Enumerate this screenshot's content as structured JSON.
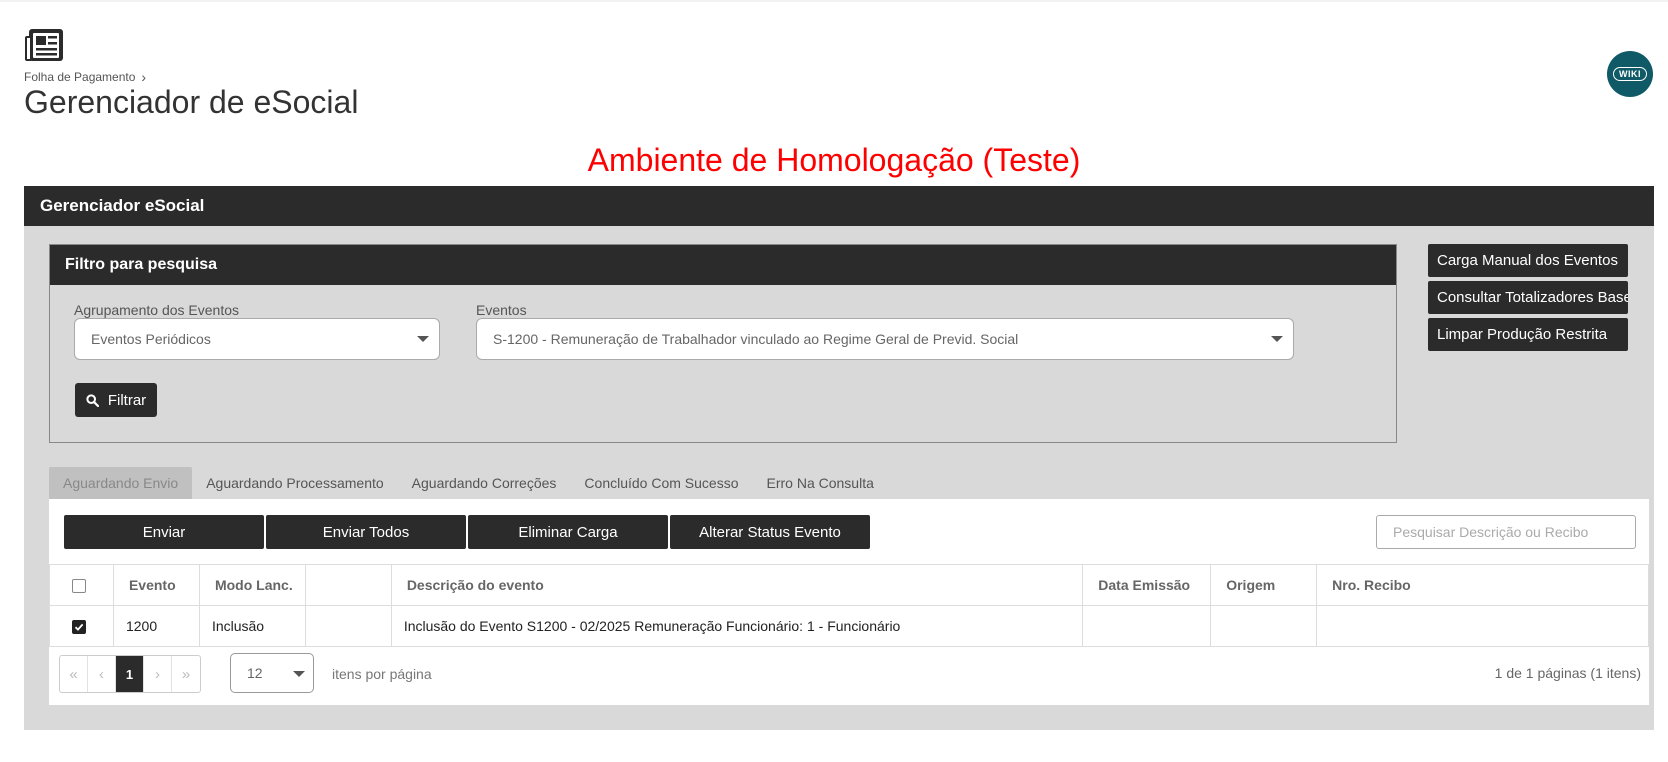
{
  "header": {
    "breadcrumb": "Folha de Pagamento",
    "title": "Gerenciador de eSocial",
    "wiki_label": "WIKI"
  },
  "environment_banner": "Ambiente de Homologação (Teste)",
  "panel": {
    "title": "Gerenciador eSocial"
  },
  "filter": {
    "title": "Filtro para pesquisa",
    "grouping_label": "Agrupamento dos Eventos",
    "grouping_value": "Eventos Periódicos",
    "events_label": "Eventos",
    "events_value": "S-1200 - Remuneração de Trabalhador vinculado ao Regime Geral de Previd. Social",
    "filter_button": "Filtrar"
  },
  "side_buttons": [
    "Carga Manual dos Eventos",
    "Consultar Totalizadores Base",
    "Limpar Produção Restrita"
  ],
  "tabs": [
    "Aguardando Envio",
    "Aguardando Processamento",
    "Aguardando Correções",
    "Concluído Com Sucesso",
    "Erro Na Consulta"
  ],
  "actions": [
    "Enviar",
    "Enviar Todos",
    "Eliminar Carga",
    "Alterar Status Evento"
  ],
  "search": {
    "placeholder": "Pesquisar Descrição ou Recibo"
  },
  "table": {
    "columns": [
      "Evento",
      "Modo Lanc.",
      "",
      "Descrição do evento",
      "Data Emissão",
      "Origem",
      "Nro. Recibo"
    ],
    "rows": [
      {
        "checked": true,
        "evento": "1200",
        "modo": "Inclusão",
        "extra": "",
        "descricao": "Inclusão do Evento S1200 - 02/2025 Remuneração Funcionário: 1 - Funcionário",
        "data_emissao": "",
        "origem": "",
        "recibo": ""
      }
    ]
  },
  "pagination": {
    "first": "«",
    "prev": "‹",
    "current_page": "1",
    "next": "›",
    "last": "»",
    "page_size": "12",
    "per_page_label": "itens por página",
    "info": "1 de 1 páginas (1 itens)"
  },
  "colors": {
    "dark": "#2b2b2b",
    "panel_bg": "#d9d9d9",
    "banner": "#ff0000",
    "wiki": "#0f5a66"
  }
}
